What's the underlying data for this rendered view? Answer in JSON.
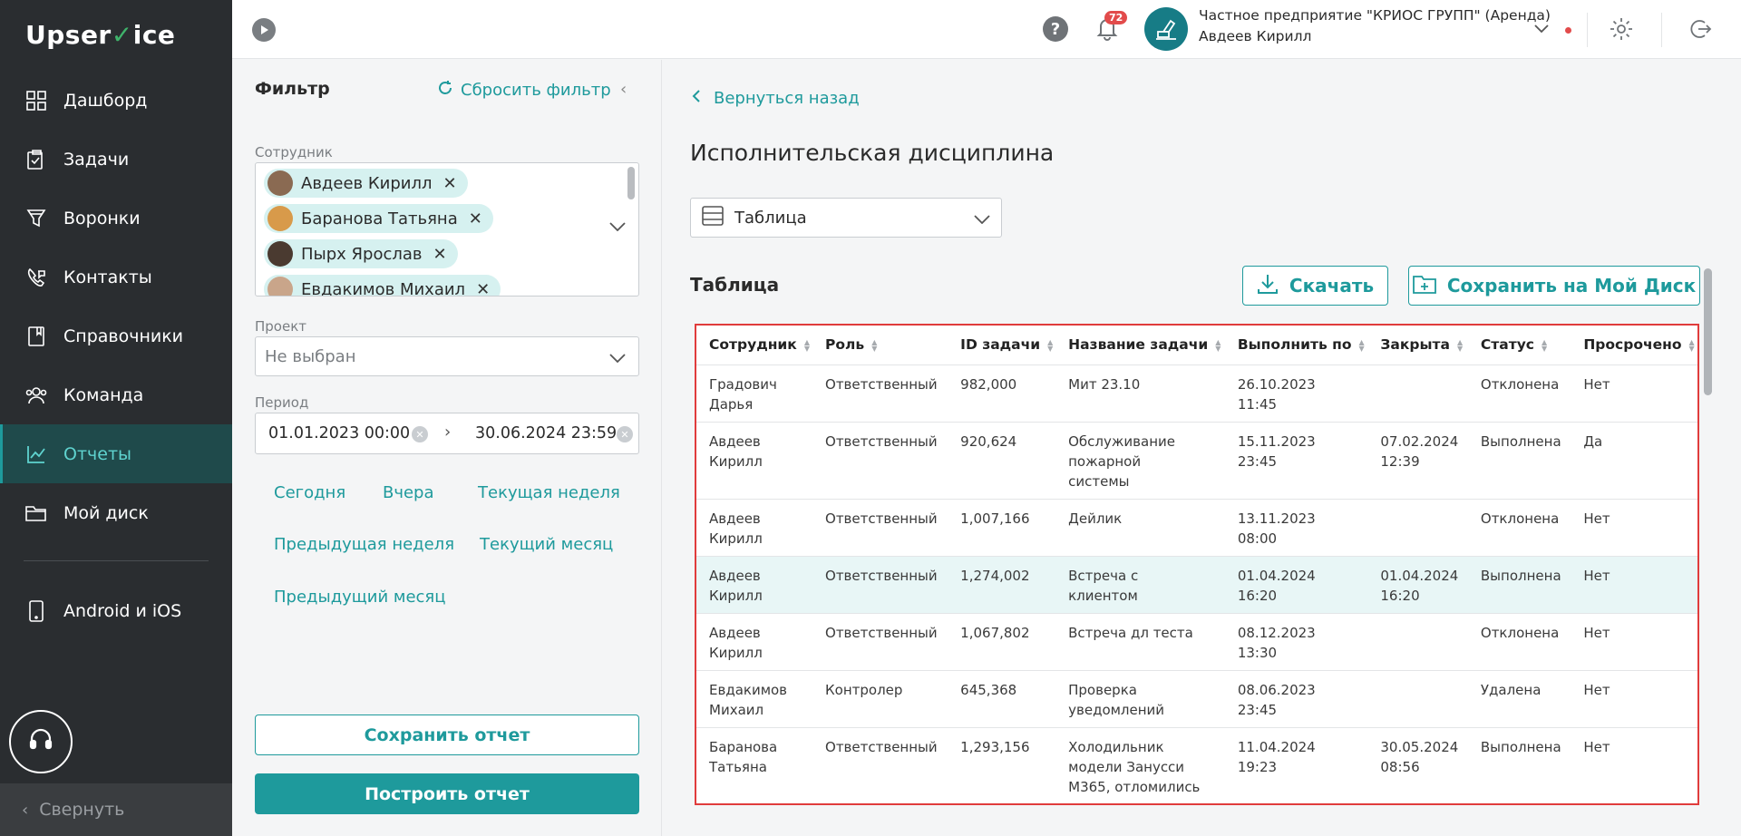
{
  "brand": {
    "logo_pre": "Upser",
    "logo_check": "✓",
    "logo_post": "ice"
  },
  "sidebar": {
    "items": [
      {
        "label": "Дашборд",
        "icon": "dashboard-icon"
      },
      {
        "label": "Задачи",
        "icon": "tasks-icon"
      },
      {
        "label": "Воронки",
        "icon": "funnel-icon"
      },
      {
        "label": "Контакты",
        "icon": "contacts-icon"
      },
      {
        "label": "Справочники",
        "icon": "book-icon"
      },
      {
        "label": "Команда",
        "icon": "team-icon"
      },
      {
        "label": "Отчеты",
        "icon": "chart-icon",
        "active": true
      },
      {
        "label": "Мой диск",
        "icon": "folder-icon"
      }
    ],
    "mobile_label": "Android и iOS",
    "collapse_label": "Свернуть"
  },
  "topbar": {
    "notifications": "72",
    "org_name": "Частное предприятие \"КРИОС ГРУПП\" (Аренда)",
    "user_name": "Авдеев Кирилл"
  },
  "filter": {
    "title": "Фильтр",
    "reset_label": "Сбросить фильтр",
    "employee_label": "Сотрудник",
    "employees": [
      {
        "name": "Авдеев Кирилл",
        "color": "#8a6a52"
      },
      {
        "name": "Баранова Татьяна",
        "color": "#d89a4a"
      },
      {
        "name": "Пырх Ярослав",
        "color": "#4a3a30"
      },
      {
        "name": "Евдакимов Михаил",
        "color": "#c9a58a"
      }
    ],
    "project_label": "Проект",
    "project_value": "Не выбран",
    "period_label": "Период",
    "date_from": "01.01.2023 00:00",
    "date_to": "30.06.2024 23:59",
    "quick": {
      "today": "Сегодня",
      "yesterday": "Вчера",
      "this_week": "Текущая неделя",
      "prev_week": "Предыдущая неделя",
      "this_month": "Текущий месяц",
      "prev_month": "Предыдущий месяц"
    },
    "save_report": "Сохранить отчет",
    "build_report": "Построить отчет"
  },
  "main": {
    "back_label": "Вернуться назад",
    "title": "Исполнительская дисциплина",
    "view_value": "Таблица",
    "section_title": "Таблица",
    "download_label": "Скачать",
    "save_disk_label": "Сохранить на Мой Диск"
  },
  "table": {
    "headers": [
      "Сотрудник",
      "Роль",
      "ID задачи",
      "Название задачи",
      "Выполнить по",
      "Закрыта",
      "Статус",
      "Просрочено"
    ],
    "rows": [
      [
        "Градович\nДарья",
        "Ответственный",
        "982,000",
        "Мит 23.10",
        "26.10.2023\n11:45",
        "",
        "Отклонена",
        "Нет"
      ],
      [
        "Авдеев\nКирилл",
        "Ответственный",
        "920,624",
        "Обслуживание\nпожарной\nсистемы",
        "15.11.2023\n23:45",
        "07.02.2024\n12:39",
        "Выполнена",
        "Да"
      ],
      [
        "Авдеев\nКирилл",
        "Ответственный",
        "1,007,166",
        "Дейлик",
        "13.11.2023\n08:00",
        "",
        "Отклонена",
        "Нет"
      ],
      [
        "Авдеев\nКирилл",
        "Ответственный",
        "1,274,002",
        "Встреча с\nклиентом",
        "01.04.2024\n16:20",
        "01.04.2024\n16:20",
        "Выполнена",
        "Нет"
      ],
      [
        "Авдеев\nКирилл",
        "Ответственный",
        "1,067,802",
        "Встреча дл теста",
        "08.12.2023\n13:30",
        "",
        "Отклонена",
        "Нет"
      ],
      [
        "Евдакимов\nМихаил",
        "Контролер",
        "645,368",
        "Проверка\nуведомлений",
        "08.06.2023\n23:45",
        "",
        "Удалена",
        "Нет"
      ],
      [
        "Баранова\nТатьяна",
        "Ответственный",
        "1,293,156",
        "Холодильник\nмодели Занусси\nМ365, отломились",
        "11.04.2024\n19:23",
        "30.05.2024\n08:56",
        "Выполнена",
        "Нет"
      ]
    ],
    "highlighted_row": 3
  }
}
